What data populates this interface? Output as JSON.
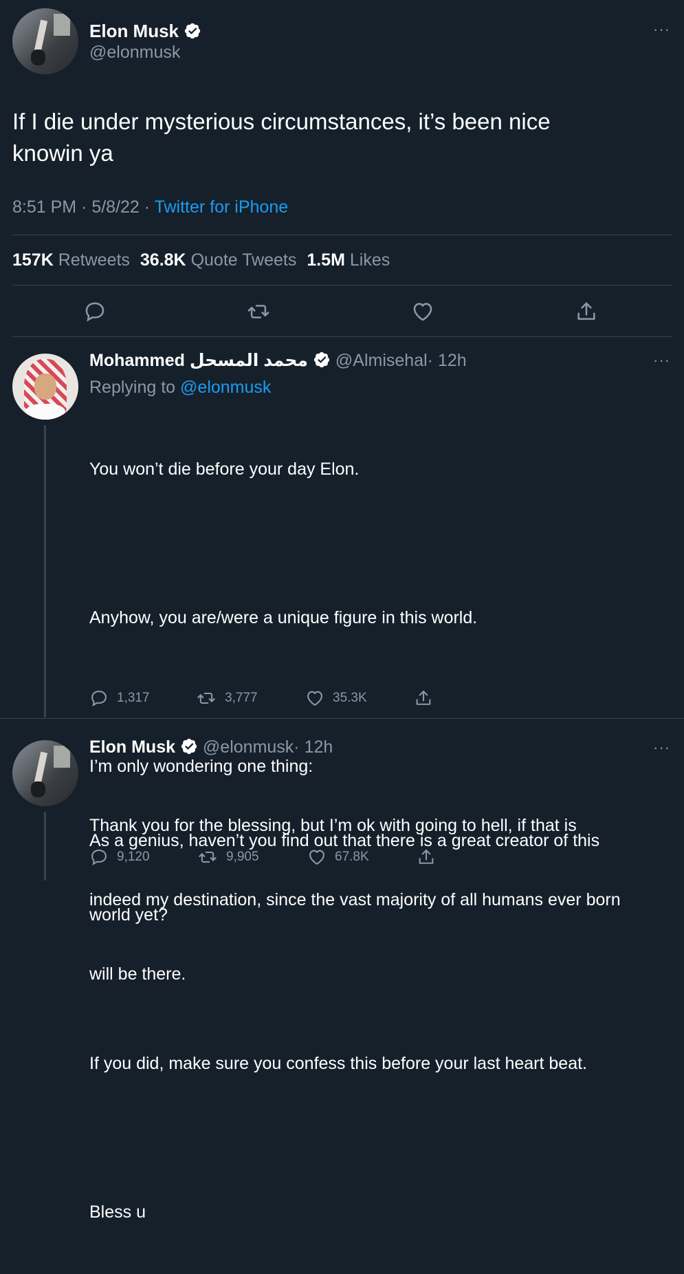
{
  "main_tweet": {
    "author_name": "Elon Musk",
    "handle": "@elonmusk",
    "text_line1": "If I die under mysterious circumstances, it’s been nice",
    "text_line2": "knowin ya",
    "time": "8:51 PM · 5/8/22 · ",
    "source": "Twitter for iPhone",
    "retweets_count": "157K",
    "retweets_label": "Retweets",
    "quotes_count": "36.8K",
    "quotes_label": "Quote Tweets",
    "likes_count": "1.5M",
    "likes_label": "Likes",
    "more": "···"
  },
  "reply1": {
    "author_name": "Mohammed محمد المسحل",
    "handle": "@Almisehal",
    "time": "· 12h",
    "replying_to_label": "Replying to",
    "replying_to_handle": "@elonmusk",
    "text_p1": "You won’t die before your day Elon.",
    "text_p2": "Anyhow, you are/were a unique figure in this world.",
    "text_p3_l1": "I’m only wondering one thing:",
    "text_p3_l2": "As a genius, haven’t you find out that there is a great creator of this",
    "text_p3_l3": "world yet?",
    "text_p4": "If you did, make sure you confess this before your last heart beat.",
    "text_p5": "Bless u",
    "replies": "1,317",
    "retweets": "3,777",
    "likes": "35.3K",
    "more": "···"
  },
  "reply2": {
    "author_name": "Elon Musk",
    "handle": "@elonmusk",
    "time": "· 12h",
    "text_l1": "Thank you for the blessing, but I’m ok with going to hell, if that is",
    "text_l2": "indeed my destination, since the vast majority of all humans ever born",
    "text_l3": "will be there.",
    "replies": "9,120",
    "retweets": "9,905",
    "likes": "67.8K",
    "more": "···"
  },
  "icons": [
    "verified-badge-icon",
    "reply-icon",
    "retweet-icon",
    "like-icon",
    "share-icon",
    "more-icon"
  ],
  "colors": {
    "background": "#15202b",
    "text": "#ffffff",
    "secondary": "#8899a6",
    "link": "#1d9bf0",
    "divider": "#38444d"
  }
}
